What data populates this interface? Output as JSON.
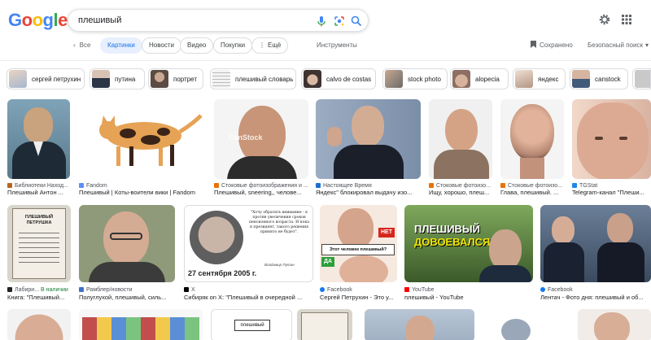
{
  "header": {
    "logo": "Google",
    "query": "плешивый"
  },
  "nav": {
    "back": "Все",
    "tabs": [
      "Картинки",
      "Новости",
      "Видео",
      "Покупки",
      "Ещё"
    ],
    "tools": "Инструменты",
    "saved": "Сохранено",
    "safesearch": "Безопасный поиск"
  },
  "suggestions": [
    "сергей петрухин",
    "путина",
    "портрет",
    "плешивый словарь",
    "calvo de costas",
    "stock photo",
    "alopecia",
    "яндекс",
    "canstock"
  ],
  "row1": [
    {
      "source": "Библиотеки Наход...",
      "caption": "Плешивый Антон ..."
    },
    {
      "source": "Fandom",
      "caption": "Плешивый | Коты-воители вики | Fandom"
    },
    {
      "source": "Стоковые фотоизображения и ...",
      "caption": "Плешивый, sneering,, челове..."
    },
    {
      "source": "Настоящее Время",
      "caption": "Яндекс\" блокировал выдачу изо..."
    },
    {
      "source": "Стоковые фотоизо...",
      "caption": "Ищу, хорошо, плеш..."
    },
    {
      "source": "Стоковые фотоизо...",
      "caption": "Глава, плешивый. ..."
    },
    {
      "source": "TGStat",
      "caption": "Telegram-канал \"Плеши..."
    }
  ],
  "row2": [
    {
      "source": "Лабири...",
      "badge": "В наличии",
      "caption": "Книга: \"Плешивый..."
    },
    {
      "source": "Рамблер/новости",
      "caption": "Полуглухой, плешивый, силь..."
    },
    {
      "source": "X",
      "caption": "Сибиряк on X: \"Плешивый в очередной ..."
    },
    {
      "source": "Facebook",
      "caption": "Сергей Петрухин - Это у..."
    },
    {
      "source": "YouTube",
      "caption": "плешивый - YouTube"
    },
    {
      "source": "Facebook",
      "caption": "Лентач - Фото дня: плешивый и об..."
    }
  ],
  "image_text": {
    "book1_title": "ПЛЕШИВЫЙ ПЕТРУШКА",
    "quote": "\"Хочу обратить внимание - я против увеличения сроков пенсионного возраста. И пока я президент, такого решения принято не будет\".",
    "quote_author": "Владимир Путин",
    "quote_date": "27 сентября 2005 г.",
    "petrukhin_q": "Этот человек плешивый?",
    "yes": "ДА",
    "no": "НЕТ",
    "yt_title1": "ПЛЕШИВЫЙ",
    "yt_title2": "ДОВОЕВАЛСЯ",
    "watermark": "CanStock",
    "sign_text": "плешивый"
  },
  "colors": {
    "accent": "#1a73e8",
    "chip_active_bg": "#e8f0fe",
    "link_source": "#4d5156"
  }
}
